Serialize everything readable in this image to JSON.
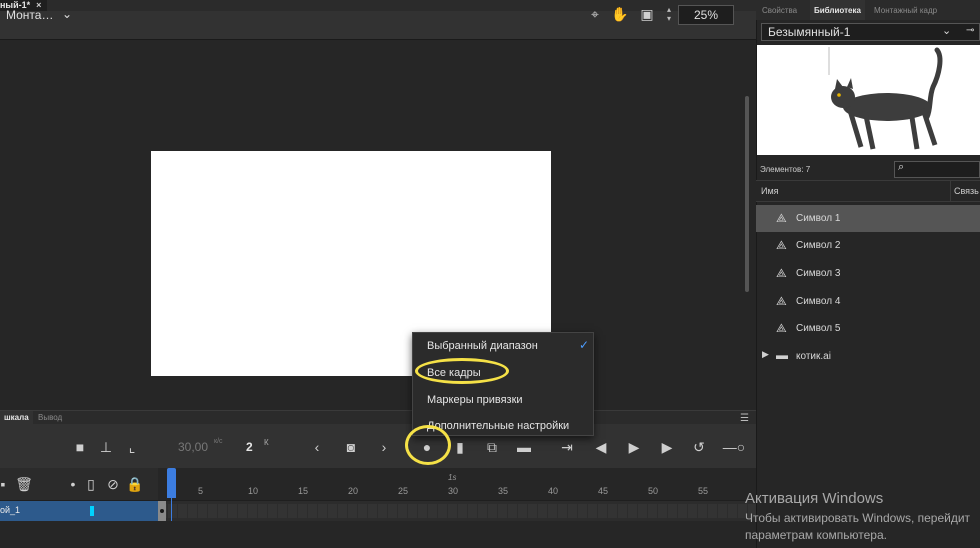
{
  "document": {
    "tab_title": "ный-1*",
    "close": "×"
  },
  "toolbar": {
    "scene": "Монта…",
    "zoom": "25%"
  },
  "timeline": {
    "tabs": [
      "шкала",
      "Вывод"
    ],
    "fps": "30,00",
    "fps_unit": "к/с",
    "current_frame": "2",
    "frame_unit": "К",
    "ruler_second": "1s",
    "ruler_numbers": [
      "5",
      "10",
      "15",
      "20",
      "25",
      "30",
      "35",
      "40",
      "45",
      "50",
      "55"
    ],
    "layer_name": "ой_1"
  },
  "menu": {
    "items": [
      "Выбранный диапазон",
      "Все кадры",
      "Маркеры привязки",
      "Дополнительные настройки"
    ],
    "checked_index": 0
  },
  "library": {
    "tabs": [
      "Свойства",
      "Библиотека",
      "Монтажный кадр"
    ],
    "document": "Безымянный-1",
    "count_label": "Элементов: 7",
    "col_name": "Имя",
    "col_links": "Связь",
    "items": [
      {
        "label": "Символ 1",
        "icon": "symbol-icon",
        "selected": true
      },
      {
        "label": "Символ 2",
        "icon": "symbol-icon",
        "selected": false
      },
      {
        "label": "Символ 3",
        "icon": "symbol-icon",
        "selected": false
      },
      {
        "label": "Символ 4",
        "icon": "symbol-icon",
        "selected": false
      },
      {
        "label": "Символ 5",
        "icon": "symbol-icon",
        "selected": false
      },
      {
        "label": "котик.ai",
        "icon": "folder-icon",
        "selected": false
      }
    ]
  },
  "watermark": {
    "title": "Активация Windows",
    "line1": "Чтобы активировать Windows, перейдит",
    "line2": "параметрам компьютера."
  },
  "colors": {
    "accent": "#3c7de0",
    "highlight_ring": "#f5e147",
    "layer_selected": "#2d5a8c"
  }
}
